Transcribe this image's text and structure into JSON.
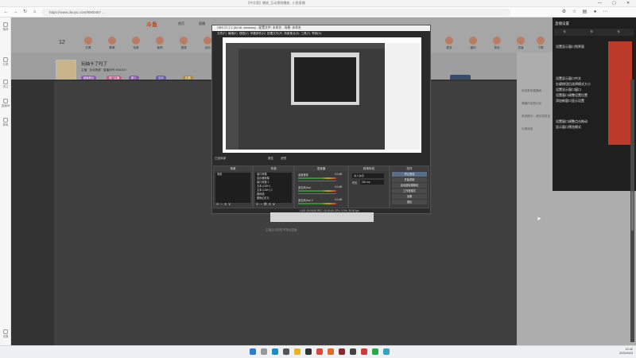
{
  "browser": {
    "tab_title": "【中文版】播放_互动视频播放 - 小鱼直播",
    "url": "https://www.douyu.com/9060457 ...",
    "win_min": "—",
    "win_max": "▢",
    "win_close": "✕"
  },
  "left_nav": [
    "推荐",
    "分类",
    "关注",
    "直播间",
    "赛事"
  ],
  "left_nav_bottom": "设置",
  "nav": {
    "logo": "斗鱼",
    "items": [
      "首页",
      "直播",
      "分类",
      "赛事",
      "电竞",
      "鱼吧",
      "视频",
      "活动",
      "更多",
      "福利",
      "背包",
      "充值",
      "下载"
    ],
    "level": "12"
  },
  "room": {
    "title": "玩抽卡了吗了",
    "sub": "主播 · 互动视频 · 直播间号 9060457",
    "tags": [
      "超级粉丝",
      "热门主播",
      "新人",
      "互动",
      "礼物"
    ]
  },
  "chat": {
    "lines": [
      "欢迎来到直播间",
      "弹幕内容显示区",
      "系统提示：请文明发言",
      "礼物消息"
    ]
  },
  "right_panel": {
    "title": "直播设置",
    "tabs": [
      "卡",
      "卡",
      "卡"
    ],
    "lines": [
      "设置显示窗口到界面",
      "设置显示窗口中文",
      "右键按钮后选择模式大小",
      "设置显示窗口窗口",
      "设置窗口调整设置位置",
      "添加新窗口显示设置",
      "设置窗口调整点击拖动",
      "显示窗口预览模式"
    ]
  },
  "obs": {
    "title": "OBS 27.2.1 (64 bit, windows) - 配置文件: 未命名 - 场景: 未命名",
    "menu": [
      "文件(F)",
      "编辑(E)",
      "视图(V)",
      "停靠部件(D)",
      "配置文件(P)",
      "场景集合(S)",
      "工具(T)",
      "帮助(H)"
    ],
    "ctrl_bar": "已选择源",
    "ctrl_btns": [
      "属性",
      "滤镜"
    ],
    "docks": {
      "scenes": "场景",
      "sources": "来源",
      "mixer": "混音器",
      "transitions": "转场特效",
      "controls": "控件"
    },
    "scene_item": "场景",
    "sources": [
      "窗口采集",
      "显示器采集",
      "窗口采集 2",
      "文本 (GDI+)",
      "文本 (GDI+) 2",
      "媒体源",
      "图像幻灯片"
    ],
    "mixer": [
      {
        "name": "桌面音频",
        "db": "0.0 dB"
      },
      {
        "name": "麦克风/Aux",
        "db": "0.0 dB"
      },
      {
        "name": "麦克风/Aux 2",
        "db": "0.0 dB"
      }
    ],
    "transition": "淡入淡出",
    "duration_label": "时长",
    "duration": "300 ms",
    "controls": [
      "停止推流",
      "开始录制",
      "启动虚拟摄像机",
      "工作室模式",
      "设置",
      "退出"
    ],
    "status": "LIVE: 00:00:00   REC: 00:00:00   CPU: 3.0%, 30.00 fps"
  },
  "footer": "主播互动视频  举报此直播",
  "tray": {
    "time": "10:42",
    "date": "2023/6/19"
  },
  "colors": {
    "accent": "#ff5d23",
    "obs_bg": "#2b2b2b",
    "dim": "#a3a3a3"
  }
}
